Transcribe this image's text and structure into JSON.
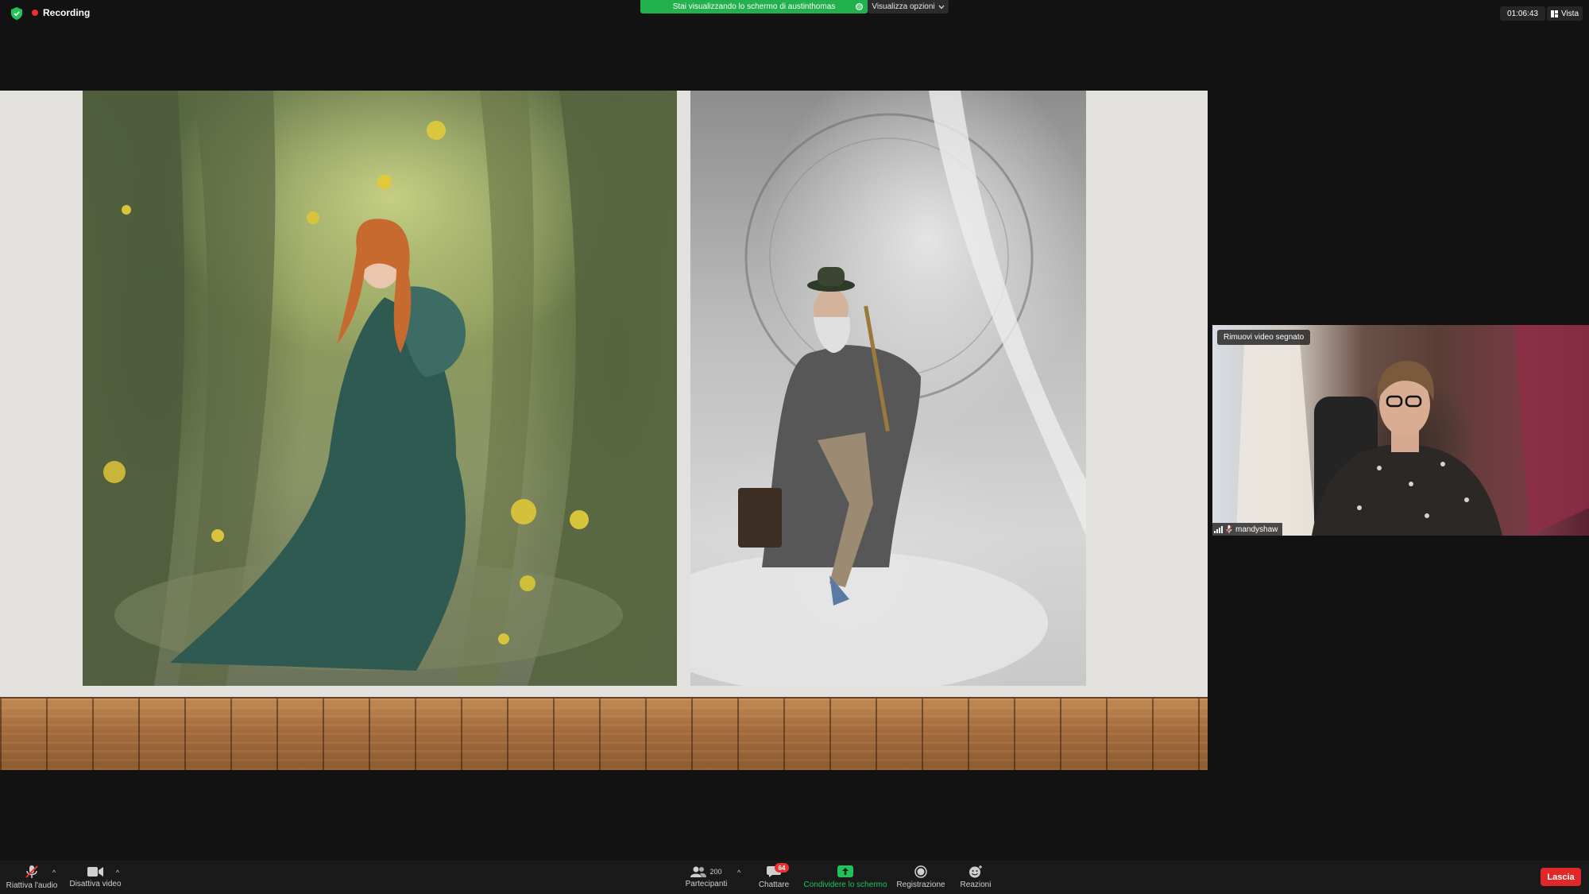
{
  "topbar": {
    "recording_label": "Recording",
    "share_banner": "Stai visualizzando lo schermo di austinthomas",
    "view_options": "Visualizza opzioni",
    "timer": "01:06:43",
    "view_button": "Vista"
  },
  "video_tile": {
    "remove_pin_label": "Rimuovi video segnato",
    "participant_name": "mandyshaw"
  },
  "toolbar": {
    "unmute_label": "Riattiva l'audio",
    "video_label": "Disattiva video",
    "participants_label": "Partecipanti",
    "participants_count": "200",
    "chat_label": "Chattare",
    "chat_badge": "64",
    "share_label": "Condividere lo schermo",
    "record_label": "Registrazione",
    "reactions_label": "Reazioni",
    "leave_label": "Lascia"
  },
  "colors": {
    "share_green": "#22b14c",
    "recording_red": "#e5312f",
    "leave_red": "#e02828",
    "background": "#121212"
  }
}
